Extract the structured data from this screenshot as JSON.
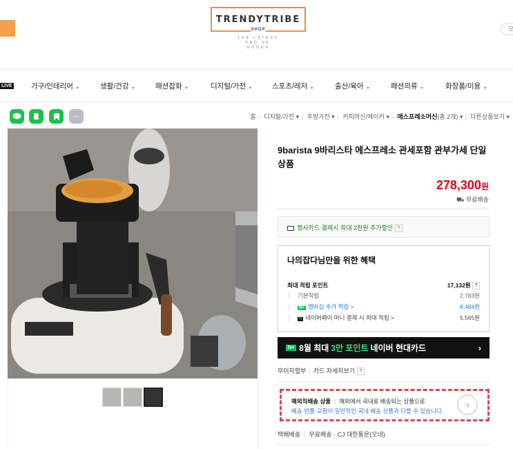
{
  "logo": {
    "name": "TRENDYTRIBE",
    "sub": "SHOP",
    "tagline": [
      "THE LATEST",
      "FAD OF",
      "GOODS"
    ]
  },
  "top_right": "오",
  "nav": {
    "live": "LIVE",
    "items": [
      "가구/인테리어",
      "생활/건강",
      "패션잡화",
      "디지털/가전",
      "스포츠/레저",
      "출산/육아",
      "패션의류",
      "화장품/미용"
    ]
  },
  "share": {
    "more": "···"
  },
  "breadcrumb": {
    "home": "홈",
    "c1": "디지털/가전",
    "c2": "주방가전",
    "c3": "커피머신/메이커",
    "c4": "에스프레소머신",
    "c4_count": "(총 2개)",
    "other": "다른상품보기"
  },
  "product": {
    "title": "9barista 9바리스타 에스프레소 관세포함 관부가세 단일상품",
    "price": "278,300",
    "won": "원",
    "shipping": "무료배송"
  },
  "card_promo": "행사카드 결제시 최대 2천원 추가할인",
  "benefit": {
    "title": "나의잡다님만을 위한 혜택",
    "max_label": "최대 적립 포인트",
    "max_val": "17,132원",
    "basic_label": "기본적립",
    "basic_val": "2,783원",
    "membership_label": "멤버십 추가 적립 >",
    "membership_val": "8,484원",
    "pay_label": "네이버페이 머니 결제 시 최대 적립 >",
    "pay_val": "5,565원"
  },
  "banner": {
    "pre": "8월 최대",
    "hl": "3만 포인트",
    "post": "네이버 현대카드"
  },
  "install": {
    "a": "무이자할부",
    "b": "카드 자세히보기"
  },
  "overseas": {
    "title": "해외직배송 상품",
    "desc": "해외에서 국내로 배송되는 상품으로",
    "desc2": "배송·반품·교환이 일반적인 국내 배송 상품과 다를 수 있습니다."
  },
  "delivery": {
    "a": "택배배송",
    "b": "무료배송 · CJ 대한통운(오네)"
  }
}
